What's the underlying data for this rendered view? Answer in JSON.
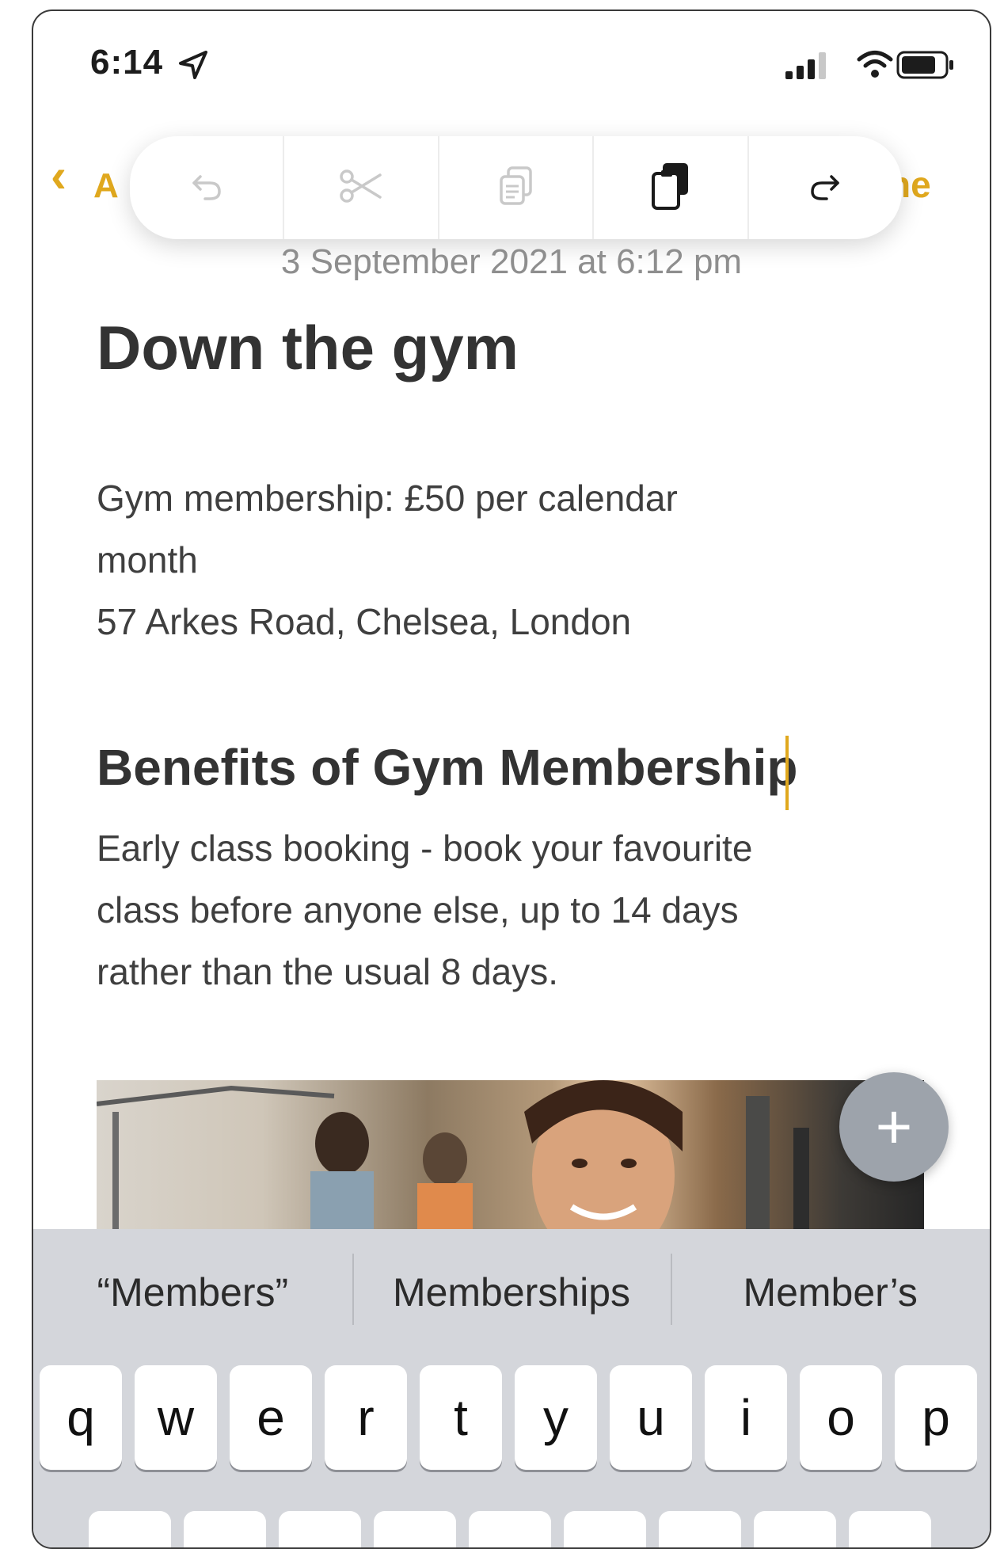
{
  "status_bar": {
    "time": "6:14"
  },
  "nav": {
    "back_partial": "A",
    "done_partial": "ne"
  },
  "edit_toolbar": {
    "buttons": [
      "undo-icon",
      "cut-icon",
      "copy-icon",
      "paste-icon",
      "redo-icon"
    ]
  },
  "note": {
    "date": "3 September 2021 at 6:12 pm",
    "title": "Down the gym",
    "lines_1": [
      "Gym membership: £50 per calendar",
      "month",
      "57 Arkes Road, Chelsea, London"
    ],
    "heading": "Benefits of  Gym Membership",
    "lines_2": [
      "Early class booking - book your favourite",
      "class before anyone else, up to 14 days",
      "rather than the usual 8 days."
    ]
  },
  "keyboard": {
    "suggestions": [
      "“Members”",
      "Memberships",
      "Member’s"
    ],
    "row1": [
      "q",
      "w",
      "e",
      "r",
      "t",
      "y",
      "u",
      "i",
      "o",
      "p"
    ]
  },
  "colors": {
    "accent": "#e0a81e",
    "keyboard_bg": "#d4d6db"
  }
}
